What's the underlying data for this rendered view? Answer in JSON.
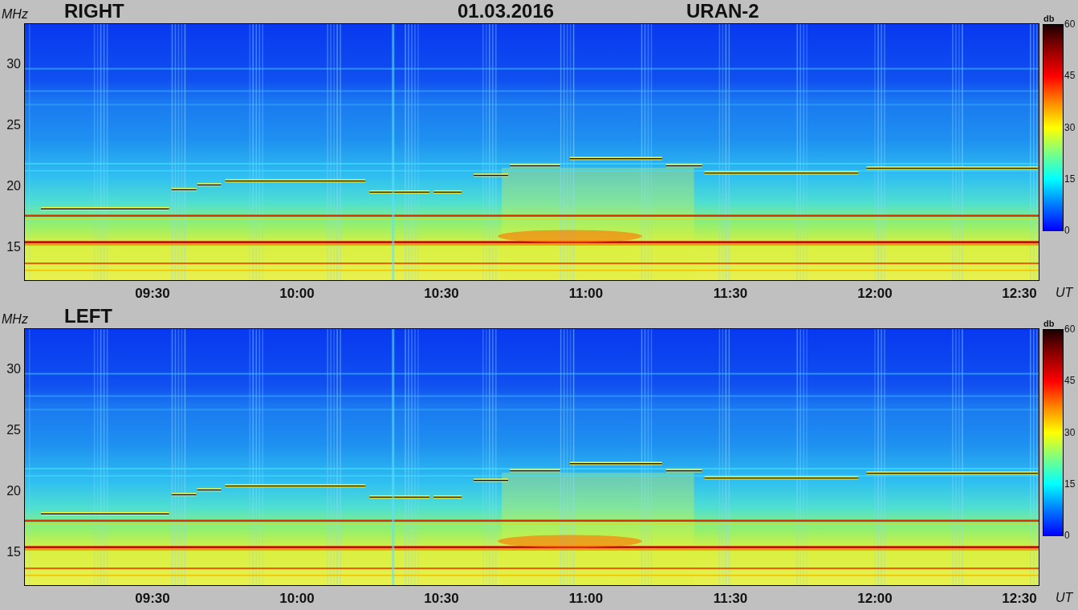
{
  "panels": [
    {
      "channel": "RIGHT",
      "date": "01.03.2016",
      "instrument": "URAN-2",
      "y_unit": "MHz",
      "y_ticks": [
        "30",
        "25",
        "20",
        "15"
      ],
      "x_ticks": [
        "09:30",
        "10:00",
        "10:30",
        "11:00",
        "11:30",
        "12:00",
        "12:30"
      ],
      "x_unit": "UT",
      "colorbar": {
        "unit": "db",
        "ticks": [
          "60",
          "45",
          "30",
          "15",
          "0"
        ]
      }
    },
    {
      "channel": "LEFT",
      "y_unit": "MHz",
      "y_ticks": [
        "30",
        "25",
        "20",
        "15"
      ],
      "x_ticks": [
        "09:30",
        "10:00",
        "10:30",
        "11:00",
        "11:30",
        "12:00",
        "12:30"
      ],
      "x_unit": "UT",
      "colorbar": {
        "unit": "db",
        "ticks": [
          "60",
          "45",
          "30",
          "15",
          "0"
        ]
      }
    }
  ]
}
